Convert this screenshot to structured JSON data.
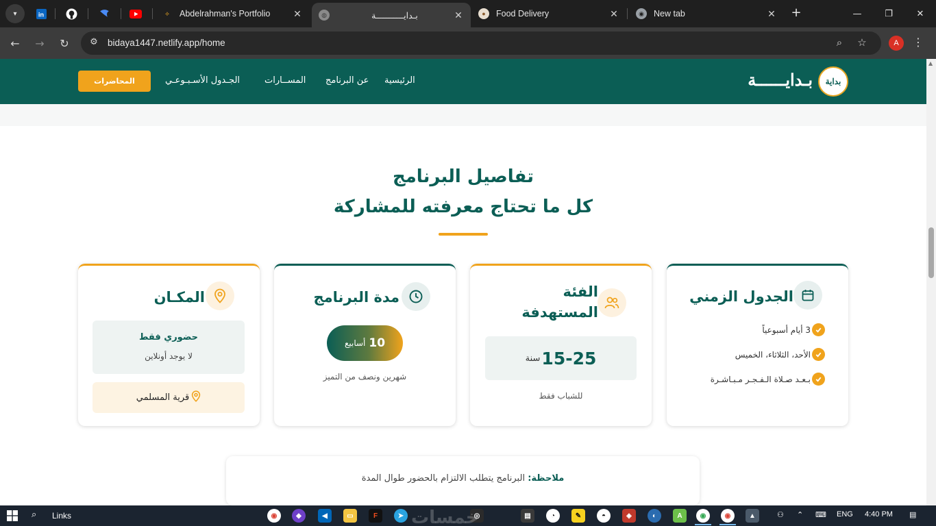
{
  "browser": {
    "tabs": [
      {
        "title": "Abdelrahman's Portfolio"
      },
      {
        "title": "بـدايـــــــــــة"
      },
      {
        "title": "Food Delivery"
      },
      {
        "title": "New tab"
      }
    ],
    "url": "bidaya1447.netlify.app/home",
    "profile_initial": "A"
  },
  "header": {
    "logo_badge": "بداية",
    "logo_text": "بـدايــــــة",
    "nav": [
      "الرئيسية",
      "عن البرنامج",
      "المســارات",
      "الجـدول الأسـبـوعـي"
    ],
    "cta": "المحاضرات"
  },
  "section": {
    "title": "تفاصيل البرنامج",
    "subtitle": "كل ما تحتاج معرفته للمشاركة"
  },
  "cards": {
    "schedule": {
      "title": "الجدول الزمني",
      "items": [
        "3 أيام أسبوعياً",
        "الأحد، الثلاثاء، الخميس",
        "بـعـد صـلاة الـفـجـر مـبـاشـرة"
      ]
    },
    "audience": {
      "title_line1": "الفئة",
      "title_line2": "المستهدفة",
      "age": "15-25",
      "age_unit": "سنة",
      "note": "للشباب فقط"
    },
    "duration": {
      "title": "مدة البرنامج",
      "weeks": "10",
      "weeks_unit": "أسابيع",
      "note": "شهرين ونصف من التميز"
    },
    "location": {
      "title": "المكـان",
      "mode": "حضوري فقط",
      "mode_note": "لا يوجد أونلاين",
      "place": "قرية المسلمي"
    }
  },
  "note": {
    "label": "ملاحظة:",
    "text": "البرنامج يتطلب الالتزام بالحضور طوال المدة"
  },
  "taskbar": {
    "search_label": "Links",
    "lang": "ENG",
    "time": "4:40 PM",
    "watermark": "خمسات"
  },
  "colors": {
    "brand_green": "#0b5e55",
    "accent_gold": "#f0a31c",
    "chrome_dark": "#1f1f1f"
  },
  "icons": [
    "linkedin-icon",
    "github-icon",
    "youtube-icon",
    "calendar-icon",
    "users-icon",
    "clock-icon",
    "map-pin-icon",
    "check-icon"
  ]
}
